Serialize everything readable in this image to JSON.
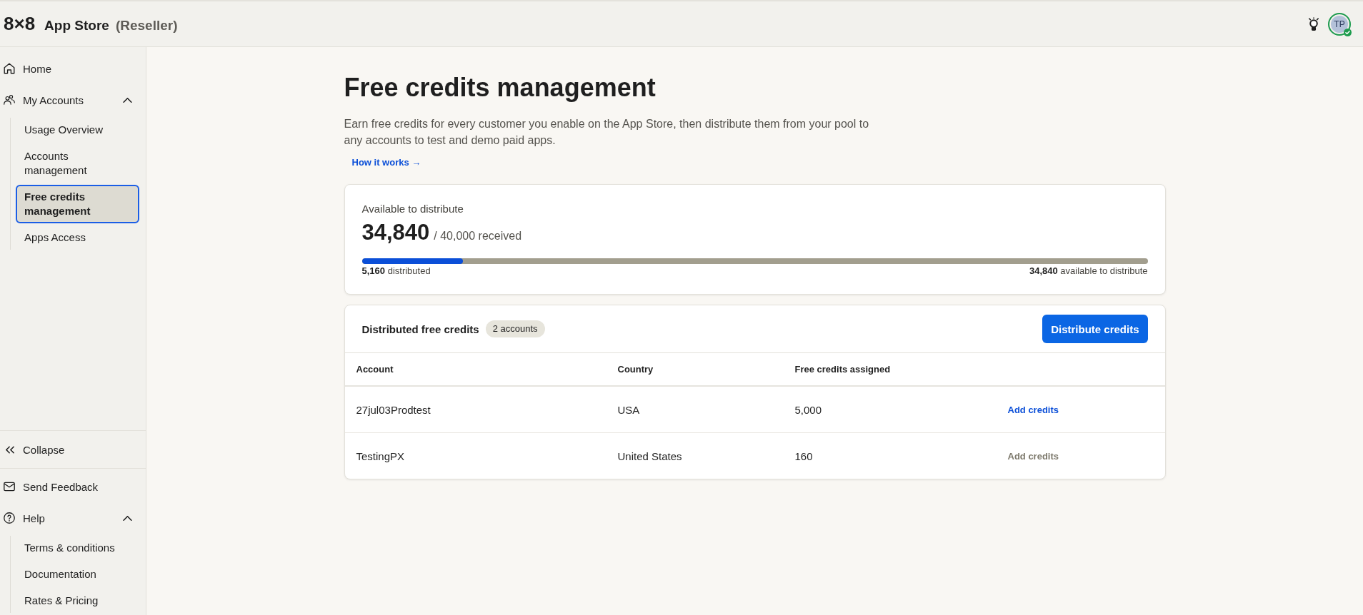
{
  "header": {
    "logo": "8×8",
    "title": "App Store",
    "subtitle": "(Reseller)",
    "avatar": {
      "initials": "TP",
      "online": true
    }
  },
  "sidebar": {
    "nav": [
      {
        "label": "Home",
        "selected": false
      },
      {
        "label": "My Accounts",
        "expanded": true,
        "children": [
          {
            "label": "Usage Overview",
            "selected": false
          },
          {
            "label": "Accounts management",
            "selected": false
          },
          {
            "label": "Free credits management",
            "selected": true
          },
          {
            "label": "Apps Access",
            "selected": false
          }
        ]
      }
    ],
    "collapse": "Collapse",
    "footer": [
      {
        "label": "Send Feedback"
      },
      {
        "label": "Help",
        "expanded": true,
        "children": [
          {
            "label": "Terms & conditions"
          },
          {
            "label": "Documentation"
          },
          {
            "label": "Rates & Pricing"
          }
        ]
      }
    ]
  },
  "page": {
    "title": "Free credits management",
    "description": "Earn free credits for every customer you enable on the App Store, then distribute them from your pool to any accounts to test and demo paid apps.",
    "link": "How it works →"
  },
  "summary": {
    "label": "Available to distribute",
    "amount": "34,840",
    "total": "/ 40,000 received",
    "level": 0.129,
    "distributed": "**5,160** distributed",
    "available": "**34,840** available to distribute"
  },
  "distributed": {
    "title": "Distributed free credits",
    "badge": "2 accounts",
    "button": "Distribute credits",
    "table": {
      "columns": [
        "Account",
        "Country",
        "Free credits assigned"
      ],
      "rows": [
        {
          "cells": [
            "27jul03Prodtest",
            "USA",
            "5,000"
          ],
          "action": {
            "label": "Add credits",
            "disabled": false
          }
        },
        {
          "cells": [
            "TestingPX",
            "United States",
            "160"
          ],
          "action": {
            "label": "Add credits",
            "disabled": true
          }
        }
      ]
    }
  }
}
